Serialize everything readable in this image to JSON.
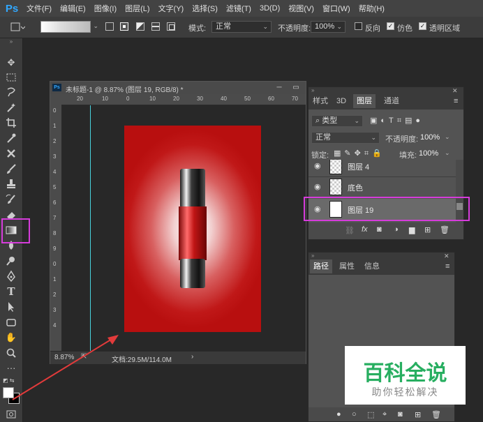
{
  "app": {
    "logo": "Ps"
  },
  "menu": [
    "文件(F)",
    "编辑(E)",
    "图像(I)",
    "图层(L)",
    "文字(Y)",
    "选择(S)",
    "滤镜(T)",
    "3D(D)",
    "视图(V)",
    "窗口(W)",
    "帮助(H)"
  ],
  "options": {
    "mode_label": "模式:",
    "mode_value": "正常",
    "opacity_label": "不透明度:",
    "opacity_value": "100%",
    "reverse_label": "反向",
    "dither_label": "仿色",
    "transparency_label": "透明区域",
    "reverse_checked": false,
    "dither_checked": true,
    "transparency_checked": true
  },
  "document": {
    "title": "未标题-1 @ 8.87% (图层 19, RGB/8) *",
    "zoom": "8.87%",
    "doc_info": "文档:29.5M/114.0M",
    "ruler_h": [
      "20",
      "10",
      "0",
      "10",
      "20",
      "30",
      "40",
      "50",
      "60",
      "70"
    ],
    "ruler_v": [
      "0",
      "1",
      "2",
      "3",
      "4",
      "5",
      "6",
      "7",
      "8",
      "9",
      "0",
      "1",
      "2",
      "3",
      "4"
    ]
  },
  "layers_panel": {
    "tabs": [
      "样式",
      "3D",
      "图层",
      "通道"
    ],
    "active_tab": "图层",
    "filter_label": "类型",
    "blend_mode": "正常",
    "opacity_label": "不透明度:",
    "opacity_value": "100%",
    "lock_label": "锁定:",
    "fill_label": "填充:",
    "fill_value": "100%",
    "layers": [
      {
        "name": "图层 4"
      },
      {
        "name": "底色"
      },
      {
        "name": "图层 19"
      }
    ],
    "footer_icons": [
      "link-icon",
      "fx-icon",
      "mask-icon",
      "adjustment-icon",
      "folder-icon",
      "new-layer-icon",
      "trash-icon"
    ]
  },
  "paths_panel": {
    "tabs": [
      "路径",
      "属性",
      "信息"
    ],
    "active_tab": "路径"
  },
  "watermark": {
    "title": "百科全说",
    "subtitle": "助你轻松解决"
  },
  "colors": {
    "highlight": "#d63cdb",
    "arrow": "#e23b3b",
    "accent": "#31a8ff"
  }
}
